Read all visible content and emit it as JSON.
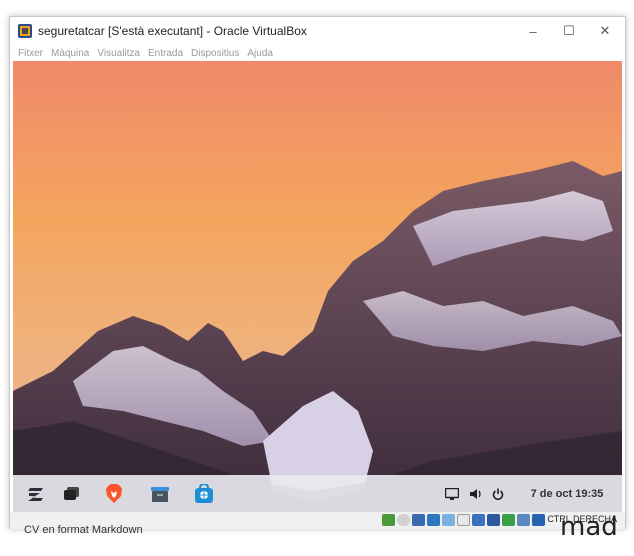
{
  "window": {
    "title": "seguretatcar [S'està executant] - Oracle VirtualBox",
    "minimize": "–",
    "maximize": "☐",
    "close": "✕"
  },
  "menu": [
    "Fitxer",
    "Màquina",
    "Visualitza",
    "Entrada",
    "Dispositius",
    "Ajuda"
  ],
  "taskbar": {
    "apps": [
      "zorin-menu-icon",
      "multitasking-icon",
      "brave-browser-icon",
      "file-manager-icon",
      "software-store-icon"
    ],
    "tray": [
      "display-icon",
      "volume-icon",
      "power-icon"
    ],
    "clock": "7 de oct  19:35"
  },
  "statusbar": {
    "host_key": "CTRL DERECHA"
  },
  "background_text": {
    "doc_title": "CV en format Markdown",
    "right_fragment": "mad"
  }
}
